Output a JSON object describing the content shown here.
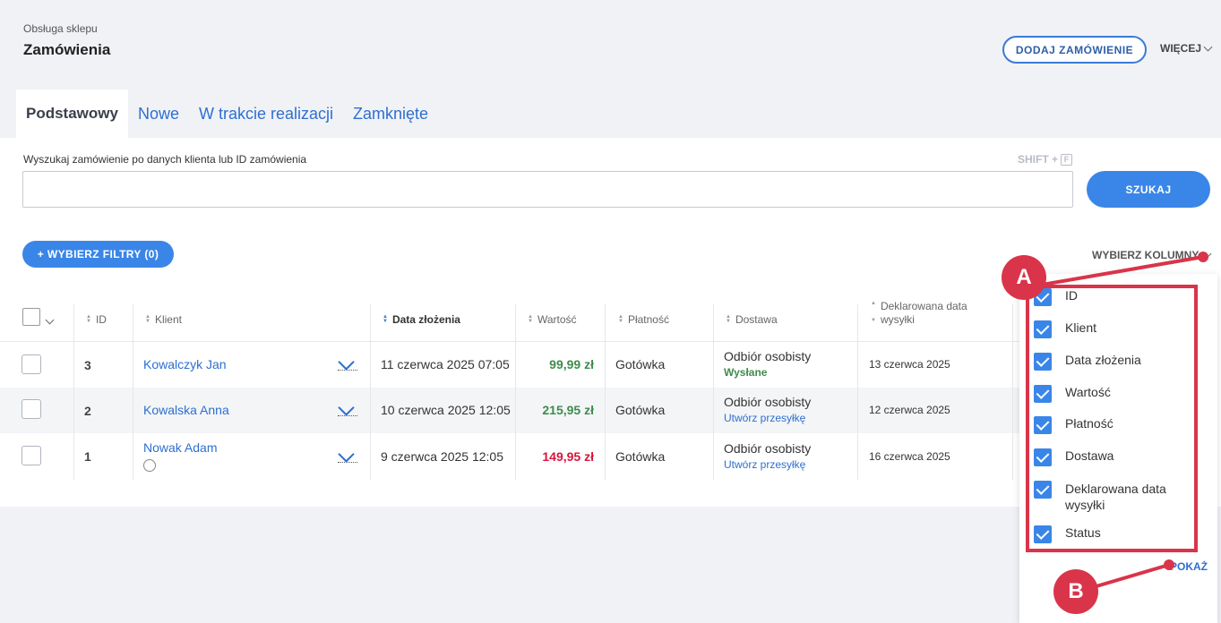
{
  "header": {
    "breadcrumb": "Obsługa sklepu",
    "title": "Zamówienia",
    "add_button": "DODAJ ZAMÓWIENIE",
    "more": "WIĘCEJ"
  },
  "tabs": [
    "Podstawowy",
    "Nowe",
    "W trakcie realizacji",
    "Zamknięte"
  ],
  "search": {
    "label": "Wyszukaj zamówienie po danych klienta lub ID zamówienia",
    "shortcut_prefix": "SHIFT +",
    "shortcut_key": "F",
    "value": "",
    "button": "SZUKAJ"
  },
  "filters": {
    "button": "+ WYBIERZ FILTRY (0)",
    "choose_columns": "WYBIERZ KOLUMNY"
  },
  "table": {
    "headers": {
      "id": "ID",
      "client": "Klient",
      "date": "Data złożenia",
      "value": "Wartość",
      "payment": "Płatność",
      "delivery": "Dostawa",
      "shipping_date": "Deklarowana data wysyłki"
    },
    "rows": [
      {
        "id": "3",
        "client": "Kowalczyk Jan",
        "date": "11 czerwca 2025 07:05",
        "value": "99,99 zł",
        "payment": "Gotówka",
        "delivery": "Odbiór osobisty",
        "delivery_status": "Wysłane",
        "shipping_date": "13 czerwca 2025"
      },
      {
        "id": "2",
        "client": "Kowalska Anna",
        "date": "10 czerwca 2025 12:05",
        "value": "215,95 zł",
        "payment": "Gotówka",
        "delivery": "Odbiór osobisty",
        "delivery_status": "Utwórz przesyłkę",
        "shipping_date": "12 czerwca 2025"
      },
      {
        "id": "1",
        "client": "Nowak Adam",
        "date": "9 czerwca 2025 12:05",
        "value": "149,95 zł",
        "payment": "Gotówka",
        "delivery": "Odbiór osobisty",
        "delivery_status": "Utwórz przesyłkę",
        "shipping_date": "16 czerwca 2025"
      }
    ]
  },
  "columns_menu": {
    "options": [
      "ID",
      "Klient",
      "Data złożenia",
      "Wartość",
      "Płatność",
      "Dostawa",
      "Deklarowana data wysyłki",
      "Status"
    ],
    "show_button": "POKAŻ"
  },
  "annotations": {
    "a": "A",
    "b": "B"
  },
  "colors": {
    "accent": "#3a86e8",
    "link": "#2d6fd0",
    "annotation": "#d9344a",
    "positive": "#3f8b4f",
    "negative": "#d9143a"
  }
}
